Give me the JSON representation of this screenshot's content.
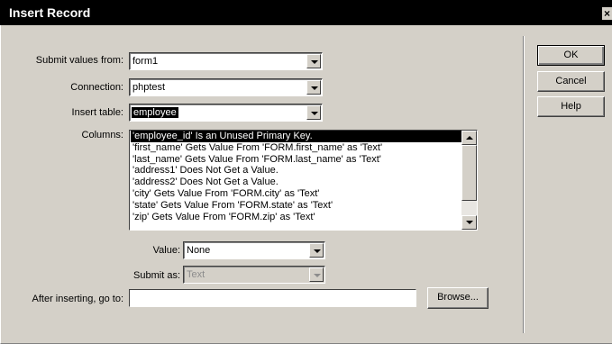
{
  "window": {
    "title": "Insert Record",
    "close_glyph": "×"
  },
  "form": {
    "submit_values_from": {
      "label": "Submit values from:",
      "value": "form1"
    },
    "connection": {
      "label": "Connection:",
      "value": "phptest"
    },
    "insert_table": {
      "label": "Insert table:",
      "value": "employee"
    },
    "columns": {
      "label": "Columns:",
      "items": [
        "'employee_id' Is an Unused Primary Key.",
        "'first_name' Gets Value From 'FORM.first_name' as 'Text'",
        "'last_name' Gets Value From 'FORM.last_name' as 'Text'",
        "'address1' Does Not Get a Value.",
        "'address2' Does Not Get a Value.",
        "'city' Gets Value From 'FORM.city' as 'Text'",
        "'state' Gets Value From 'FORM.state' as 'Text'",
        "'zip' Gets Value From 'FORM.zip' as 'Text'"
      ],
      "selected_index": 0
    },
    "value": {
      "label": "Value:",
      "value": "None"
    },
    "submit_as": {
      "label": "Submit as:",
      "value": "Text",
      "disabled": true
    },
    "after_inserting": {
      "label": "After inserting, go to:",
      "value": ""
    },
    "browse_label": "Browse..."
  },
  "buttons": {
    "ok": "OK",
    "cancel": "Cancel",
    "help": "Help"
  },
  "icons": {
    "dropdown": "chevron-down-icon",
    "scroll_up": "arrow-up-icon",
    "scroll_down": "arrow-down-icon",
    "close": "close-icon"
  }
}
